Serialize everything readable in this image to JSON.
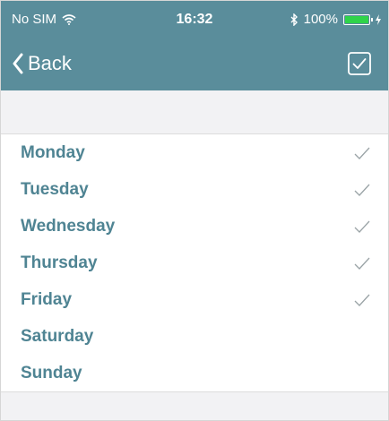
{
  "status_bar": {
    "carrier": "No SIM",
    "time": "16:32",
    "battery": "100%",
    "battery_level": 1.0
  },
  "nav": {
    "back_label": "Back",
    "back_icon": "chevron-left-icon",
    "done_icon": "checkbox-icon"
  },
  "colors": {
    "header": "#5a8d9b",
    "label": "#4f8493",
    "check": "#9aa3a6"
  },
  "days": [
    {
      "label": "Monday",
      "checked": true
    },
    {
      "label": "Tuesday",
      "checked": true
    },
    {
      "label": "Wednesday",
      "checked": true
    },
    {
      "label": "Thursday",
      "checked": true
    },
    {
      "label": "Friday",
      "checked": true
    },
    {
      "label": "Saturday",
      "checked": false
    },
    {
      "label": "Sunday",
      "checked": false
    }
  ]
}
